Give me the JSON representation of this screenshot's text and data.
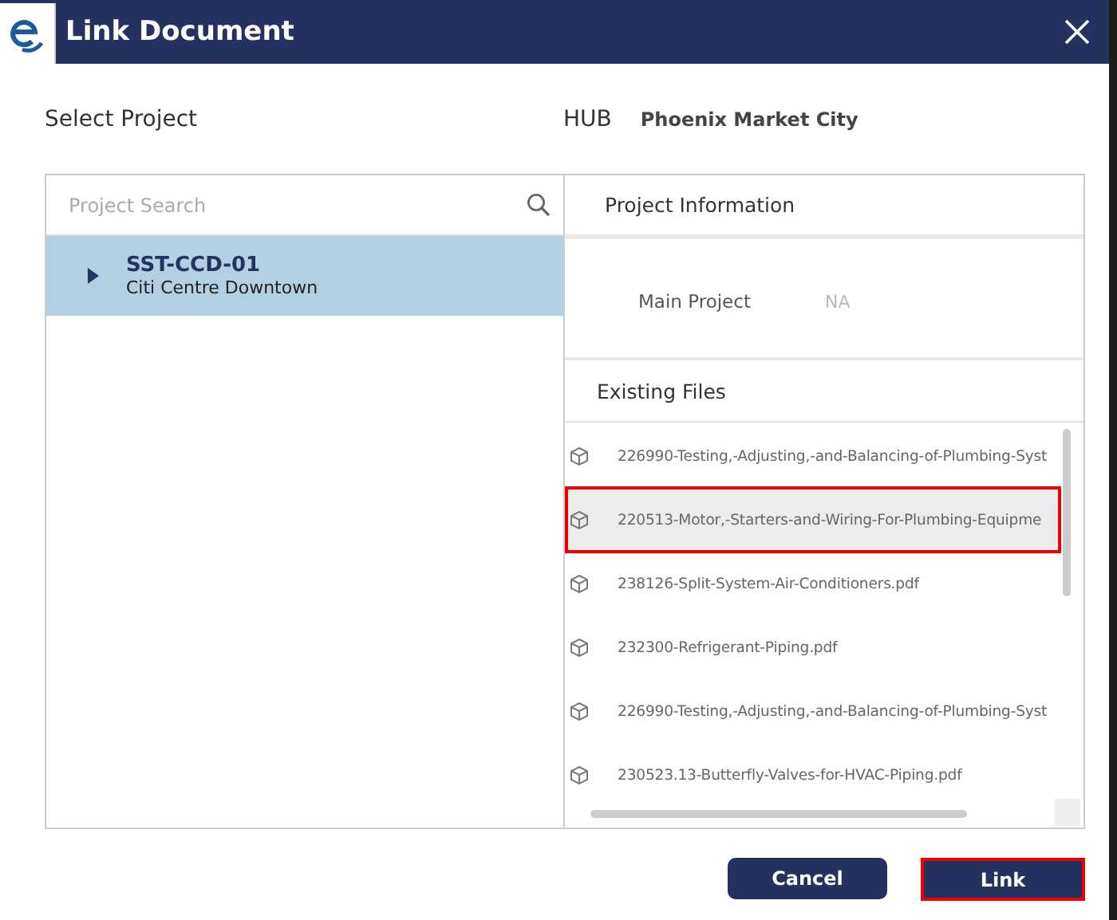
{
  "window": {
    "title": "Link Document"
  },
  "select_project": {
    "label": "Select Project"
  },
  "hub": {
    "label": "HUB",
    "value": "Phoenix Market City"
  },
  "search": {
    "placeholder": "Project Search"
  },
  "projects": [
    {
      "code": "SST-CCD-01",
      "name": "Citi Centre Downtown",
      "selected": true,
      "expanded": false
    }
  ],
  "project_information": {
    "title": "Project Information",
    "fields": [
      {
        "label": "Main Project",
        "value": "NA"
      }
    ]
  },
  "existing_files": {
    "title": "Existing Files",
    "files": [
      {
        "name": "226990-Testing,-Adjusting,-and-Balancing-of-Plumbing-Syst",
        "selected": false
      },
      {
        "name": "220513-Motor,-Starters-and-Wiring-For-Plumbing-Equipme",
        "selected": true
      },
      {
        "name": "238126-Split-System-Air-Conditioners.pdf",
        "selected": false
      },
      {
        "name": "232300-Refrigerant-Piping.pdf",
        "selected": false
      },
      {
        "name": "226990-Testing,-Adjusting,-and-Balancing-of-Plumbing-Syst",
        "selected": false
      },
      {
        "name": "230523.13-Butterfly-Valves-for-HVAC-Piping.pdf",
        "selected": false
      }
    ]
  },
  "buttons": [
    {
      "label": "Cancel",
      "focused": false
    },
    {
      "label": "Link",
      "focused": true
    }
  ]
}
